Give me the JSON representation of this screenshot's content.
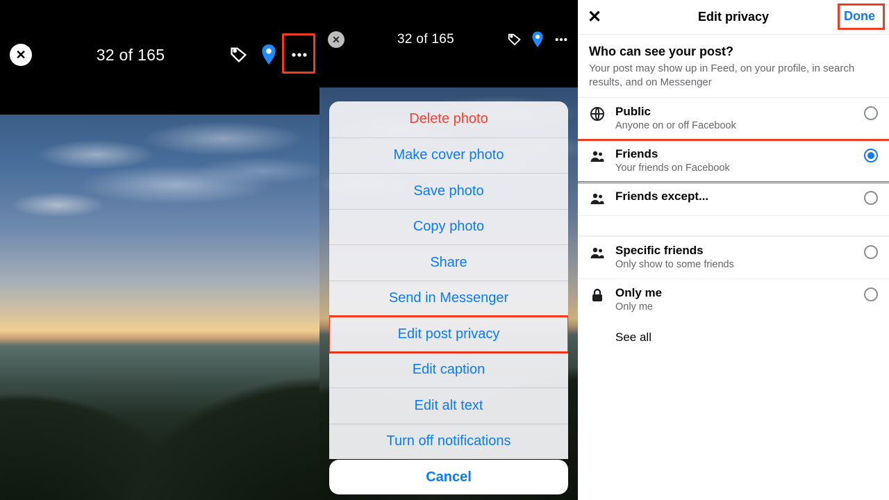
{
  "pane1": {
    "counter": "32 of 165",
    "close_label": "✕",
    "icons": {
      "tag": "tag-icon",
      "pin": "pin-icon",
      "more": "more-icon"
    }
  },
  "pane2": {
    "counter": "32 of 165",
    "close_label": "✕",
    "sheet": [
      {
        "label": "Delete photo",
        "destructive": true
      },
      {
        "label": "Make cover photo"
      },
      {
        "label": "Save photo"
      },
      {
        "label": "Copy photo"
      },
      {
        "label": "Share"
      },
      {
        "label": "Send in Messenger"
      },
      {
        "label": "Edit post privacy",
        "highlight": true
      },
      {
        "label": "Edit caption"
      },
      {
        "label": "Edit alt text"
      },
      {
        "label": "Turn off notifications"
      }
    ],
    "cancel": "Cancel"
  },
  "pane3": {
    "title": "Edit privacy",
    "done": "Done",
    "close": "✕",
    "heading": "Who can see your post?",
    "subheading": "Your post may show up in Feed, on your profile, in search results, and on Messenger",
    "options_a": [
      {
        "icon": "globe",
        "label": "Public",
        "desc": "Anyone on or off Facebook",
        "selected": false
      },
      {
        "icon": "friends",
        "label": "Friends",
        "desc": "Your friends on Facebook",
        "selected": true,
        "highlight": true
      },
      {
        "icon": "friends-except",
        "label": "Friends except...",
        "desc": "",
        "selected": false
      }
    ],
    "options_b": [
      {
        "icon": "specific",
        "label": "Specific friends",
        "desc": "Only show to some friends",
        "selected": false
      },
      {
        "icon": "lock",
        "label": "Only me",
        "desc": "Only me",
        "selected": false
      }
    ],
    "see_all": "See all"
  }
}
